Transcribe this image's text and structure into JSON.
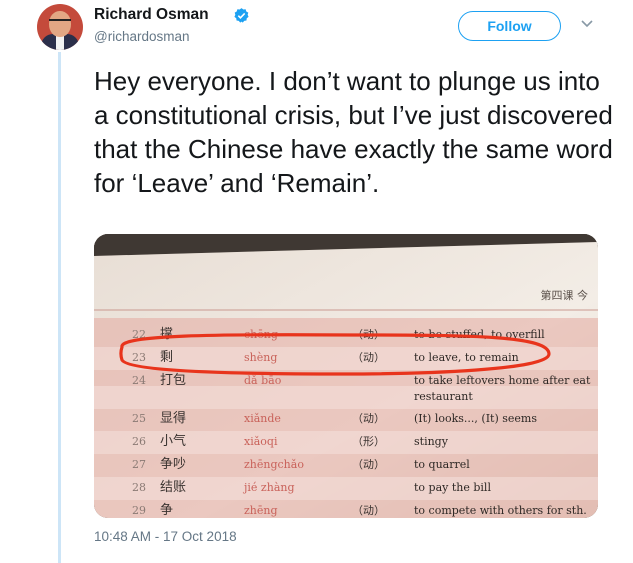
{
  "author": {
    "name": "Richard Osman",
    "handle": "@richardosman"
  },
  "follow_button": {
    "label": "Follow"
  },
  "tweet": {
    "text": "Hey everyone. I don’t want to plunge us into a constitutional crisis, but I’ve just discovered that the Chinese have exactly the same word for ‘Leave’ and ‘Remain’.",
    "timestamp": "10:48 AM - 17 Oct 2018"
  },
  "photo": {
    "header": "第四课 今",
    "rows": [
      {
        "num": "22",
        "hanzi": "撑",
        "pinyin": "chēng",
        "pos": "（动）",
        "meaning": "to be stuffed, to overfill"
      },
      {
        "num": "23",
        "hanzi": "剩",
        "pinyin": "shèng",
        "pos": "（动）",
        "meaning": "to leave, to remain"
      },
      {
        "num": "24",
        "hanzi": "打包",
        "pinyin": "dǎ bāo",
        "pos": "",
        "meaning": "to take leftovers home after eat"
      },
      {
        "num": "",
        "hanzi": "",
        "pinyin": "",
        "pos": "",
        "meaning": "restaurant"
      },
      {
        "num": "25",
        "hanzi": "显得",
        "pinyin": "xiǎnde",
        "pos": "（动）",
        "meaning": "(It) looks..., (It) seems"
      },
      {
        "num": "26",
        "hanzi": "小气",
        "pinyin": "xiǎoqi",
        "pos": "（形）",
        "meaning": "stingy"
      },
      {
        "num": "27",
        "hanzi": "争吵",
        "pinyin": "zhēngchǎo",
        "pos": "（动）",
        "meaning": "to quarrel"
      },
      {
        "num": "28",
        "hanzi": "结账",
        "pinyin": "jié zhàng",
        "pos": "",
        "meaning": "to pay the bill"
      },
      {
        "num": "29",
        "hanzi": "争",
        "pinyin": "zhēng",
        "pos": "（动）",
        "meaning": "to compete with others for sth."
      }
    ],
    "highlight_color": "#e8341c"
  },
  "colors": {
    "accent": "#1da1f2",
    "secondary_text": "#657786",
    "thread_line": "#cde5f7"
  },
  "icons": [
    "verified-badge-icon",
    "chevron-down-icon"
  ]
}
